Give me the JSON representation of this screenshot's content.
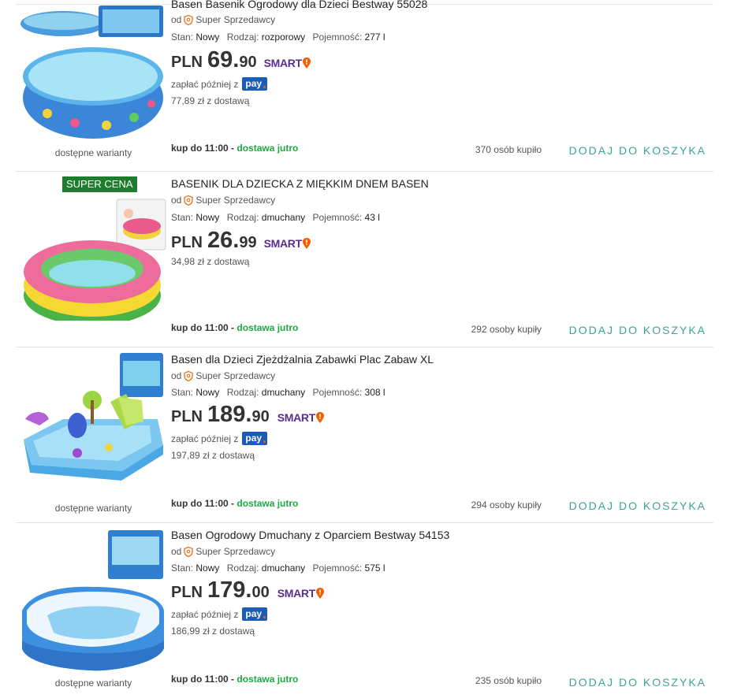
{
  "items": [
    {
      "title": "Basen Basenik Ogrodowy dla Dzieci Bestway 55028",
      "seller_prefix": "od",
      "seller": "Super Sprzedawcy",
      "stan_label": "Stan:",
      "stan": "Nowy",
      "rodzaj_label": "Rodzaj:",
      "rodzaj": "rozporowy",
      "poj_label": "Pojemność:",
      "poj": "277 l",
      "currency": "PLN",
      "price_int": "69.",
      "price_dec": "90",
      "smart": "SMART",
      "pay_later": "zapłać później z",
      "pay_logo": "pay",
      "delivery_price": "77,89 zł z dostawą",
      "variants": "dostępne warianty",
      "kup_do": "kup do 11:00",
      "kup_sep": " - ",
      "dostawa": "dostawa jutro",
      "bought": "370 osób kupiło",
      "add_to_cart": "DODAJ DO KOSZYKA"
    },
    {
      "badge": "SUPER CENA",
      "title": "BASENIK DLA DZIECKA Z MIĘKKIM DNEM BASEN",
      "seller_prefix": "od",
      "seller": "Super Sprzedawcy",
      "stan_label": "Stan:",
      "stan": "Nowy",
      "rodzaj_label": "Rodzaj:",
      "rodzaj": "dmuchany",
      "poj_label": "Pojemność:",
      "poj": "43 l",
      "currency": "PLN",
      "price_int": "26.",
      "price_dec": "99",
      "smart": "SMART",
      "delivery_price": "34,98 zł z dostawą",
      "kup_do": "kup do 11:00",
      "kup_sep": " - ",
      "dostawa": "dostawa jutro",
      "bought": "292 osoby kupiły",
      "add_to_cart": "DODAJ DO KOSZYKA"
    },
    {
      "title": "Basen dla Dzieci Zjeżdżalnia Zabawki Plac Zabaw XL",
      "seller_prefix": "od",
      "seller": "Super Sprzedawcy",
      "stan_label": "Stan:",
      "stan": "Nowy",
      "rodzaj_label": "Rodzaj:",
      "rodzaj": "dmuchany",
      "poj_label": "Pojemność:",
      "poj": "308 l",
      "currency": "PLN",
      "price_int": "189.",
      "price_dec": "90",
      "smart": "SMART",
      "pay_later": "zapłać później z",
      "pay_logo": "pay",
      "delivery_price": "197,89 zł z dostawą",
      "variants": "dostępne warianty",
      "kup_do": "kup do 11:00",
      "kup_sep": " - ",
      "dostawa": "dostawa jutro",
      "bought": "294 osoby kupiły",
      "add_to_cart": "DODAJ DO KOSZYKA"
    },
    {
      "title": "Basen Ogrodowy Dmuchany z Oparciem Bestway 54153",
      "seller_prefix": "od",
      "seller": "Super Sprzedawcy",
      "stan_label": "Stan:",
      "stan": "Nowy",
      "rodzaj_label": "Rodzaj:",
      "rodzaj": "dmuchany",
      "poj_label": "Pojemność:",
      "poj": "575 l",
      "currency": "PLN",
      "price_int": "179.",
      "price_dec": "00",
      "smart": "SMART",
      "pay_later": "zapłać później z",
      "pay_logo": "pay",
      "delivery_price": "186,99 zł z dostawą",
      "variants": "dostępne warianty",
      "kup_do": "kup do 11:00",
      "kup_sep": " - ",
      "dostawa": "dostawa jutro",
      "bought": "235 osób kupiło",
      "add_to_cart": "DODAJ DO KOSZYKA"
    }
  ],
  "colors": {
    "accent": "#3aa594",
    "delivery_green": "#1da842",
    "smart_purple": "#5a2d91",
    "pay_blue": "#1a5cb8",
    "badge_green": "#1e7d2c"
  }
}
